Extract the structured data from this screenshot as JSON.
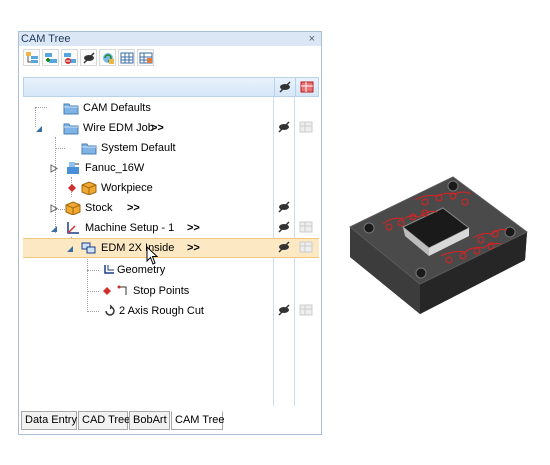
{
  "panel": {
    "title": "CAM Tree",
    "close_label": "×"
  },
  "toolbar": {
    "buttons": [
      "tree-expand-icon",
      "tree-add-icon",
      "tree-remove-icon",
      "visibility-off-icon",
      "tree-refresh-icon",
      "grid-icon",
      "grid-settings-icon"
    ]
  },
  "tree": {
    "rows": [
      {
        "label": "CAM Defaults",
        "icon": "folder-icon",
        "arrow": ""
      },
      {
        "label": "Wire EDM Job",
        "icon": "folder-icon",
        "arrow": ">>",
        "expander": "expanded",
        "hidden": true
      },
      {
        "label": "System Default",
        "icon": "folder-icon",
        "arrow": ""
      },
      {
        "label": "Fanuc_16W",
        "icon": "machine-icon",
        "arrow": "",
        "expander": "collapsed"
      },
      {
        "label": "Workpiece",
        "icon": "cube-icon",
        "arrow": ""
      },
      {
        "label": "Stock",
        "icon": "cube-icon",
        "arrow": ">>",
        "expander": "collapsed",
        "hidden": true
      },
      {
        "label": "Machine Setup - 1",
        "icon": "axis-icon",
        "arrow": ">>",
        "expander": "expanded",
        "hidden": true
      },
      {
        "label": "EDM 2X Inside",
        "icon": "operation-icon",
        "arrow": ">>",
        "expander": "expanded",
        "hidden": true,
        "selected": true
      },
      {
        "label": "Geometry",
        "icon": "geometry-icon",
        "arrow": ""
      },
      {
        "label": "Stop Points",
        "icon": "stop-points-icon",
        "arrow": ""
      },
      {
        "label": "2 Axis Rough Cut",
        "icon": "rough-cut-icon",
        "arrow": "",
        "hidden": true
      }
    ]
  },
  "tabs": [
    {
      "label": "Data Entry",
      "active": false
    },
    {
      "label": "CAD Tree",
      "active": false
    },
    {
      "label": "BobArt",
      "active": false
    },
    {
      "label": "CAM Tree",
      "active": true
    }
  ],
  "colors": {
    "selection": "#fce9c3",
    "header": "#d4e6f7",
    "accent": "#1e395b",
    "part_edge": "#e02020"
  }
}
